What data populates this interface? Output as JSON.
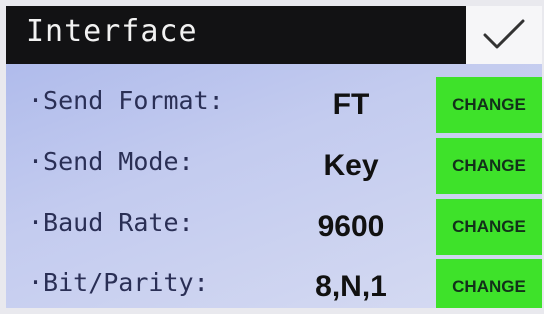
{
  "header": {
    "title": "Interface",
    "confirm_icon": "checkmark-icon"
  },
  "settings": [
    {
      "label": "·Send Format:",
      "value": "FT",
      "button": "CHANGE"
    },
    {
      "label": "·Send Mode:",
      "value": "Key",
      "button": "CHANGE"
    },
    {
      "label": "·Baud Rate:",
      "value": "9600",
      "button": "CHANGE"
    },
    {
      "label": "·Bit/Parity:",
      "value": "8,N,1",
      "button": "CHANGE"
    }
  ],
  "colors": {
    "header_bg": "#121214",
    "button_bg": "#3ee22a",
    "screen_bg": "#b8c2ee"
  }
}
